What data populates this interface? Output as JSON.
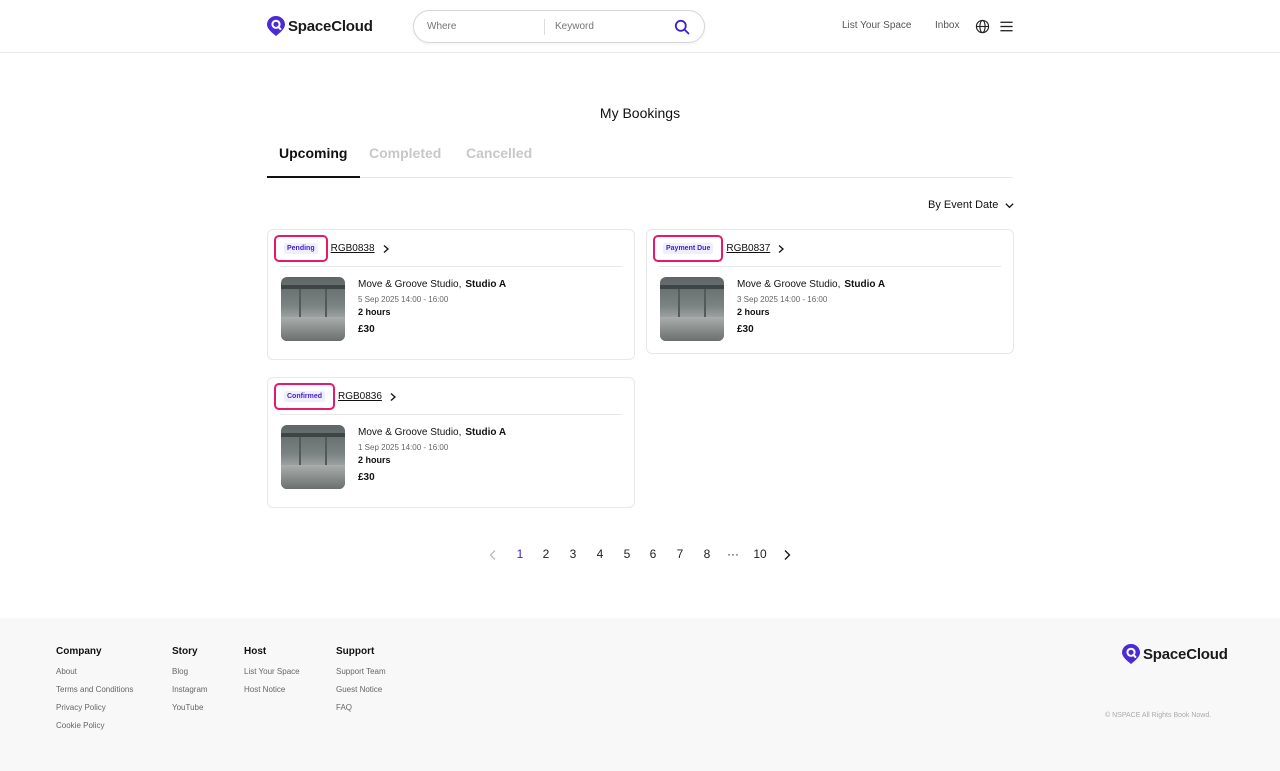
{
  "header": {
    "brand": "SpaceCloud",
    "search": {
      "where_placeholder": "Where",
      "keyword_placeholder": "Keyword"
    },
    "nav": {
      "list_space": "List Your Space",
      "inbox": "Inbox"
    }
  },
  "main": {
    "title": "My Bookings",
    "tabs": [
      {
        "label": "Upcoming",
        "active": true
      },
      {
        "label": "Completed",
        "active": false
      },
      {
        "label": "Cancelled",
        "active": false
      }
    ],
    "sort_label": "By Event Date",
    "bookings": [
      {
        "status": "Pending",
        "ref": "RGB0838",
        "venue": "Move & Groove Studio,",
        "room": "Studio A",
        "date": "5 Sep 2025 14:00 - 16:00",
        "duration": "2 hours",
        "price": "£30"
      },
      {
        "status": "Payment Due",
        "ref": "RGB0837",
        "venue": "Move & Groove Studio,",
        "room": "Studio A",
        "date": "3 Sep 2025 14:00 - 16:00",
        "duration": "2 hours",
        "price": "£30"
      },
      {
        "status": "Confirmed",
        "ref": "RGB0836",
        "venue": "Move & Groove Studio,",
        "room": "Studio A",
        "date": "1 Sep 2025 14:00 - 16:00",
        "duration": "2 hours",
        "price": "£30"
      }
    ]
  },
  "pagination": {
    "pages": [
      "1",
      "2",
      "3",
      "4",
      "5",
      "6",
      "7",
      "8",
      "···",
      "10"
    ],
    "current": "1"
  },
  "footer": {
    "columns": [
      {
        "title": "Company",
        "links": [
          "About",
          "Terms and Conditions",
          "Privacy Policy",
          "Cookie Policy"
        ]
      },
      {
        "title": "Story",
        "links": [
          "Blog",
          "Instagram",
          "YouTube"
        ]
      },
      {
        "title": "Host",
        "links": [
          "List Your Space",
          "Host Notice"
        ]
      },
      {
        "title": "Support",
        "links": [
          "Support Team",
          "Guest Notice",
          "FAQ"
        ]
      }
    ],
    "brand": "SpaceCloud",
    "copyright": "© NSPACE All Rights Book Nowd."
  },
  "colors": {
    "accent": "#3b1fd1",
    "highlight": "#e5196d",
    "brand": "#4b2bd6"
  },
  "icons": [
    "search-icon",
    "globe-icon",
    "menu-icon",
    "chevron-down-icon",
    "chevron-right-icon",
    "chevron-left-icon",
    "location-pin-icon"
  ]
}
